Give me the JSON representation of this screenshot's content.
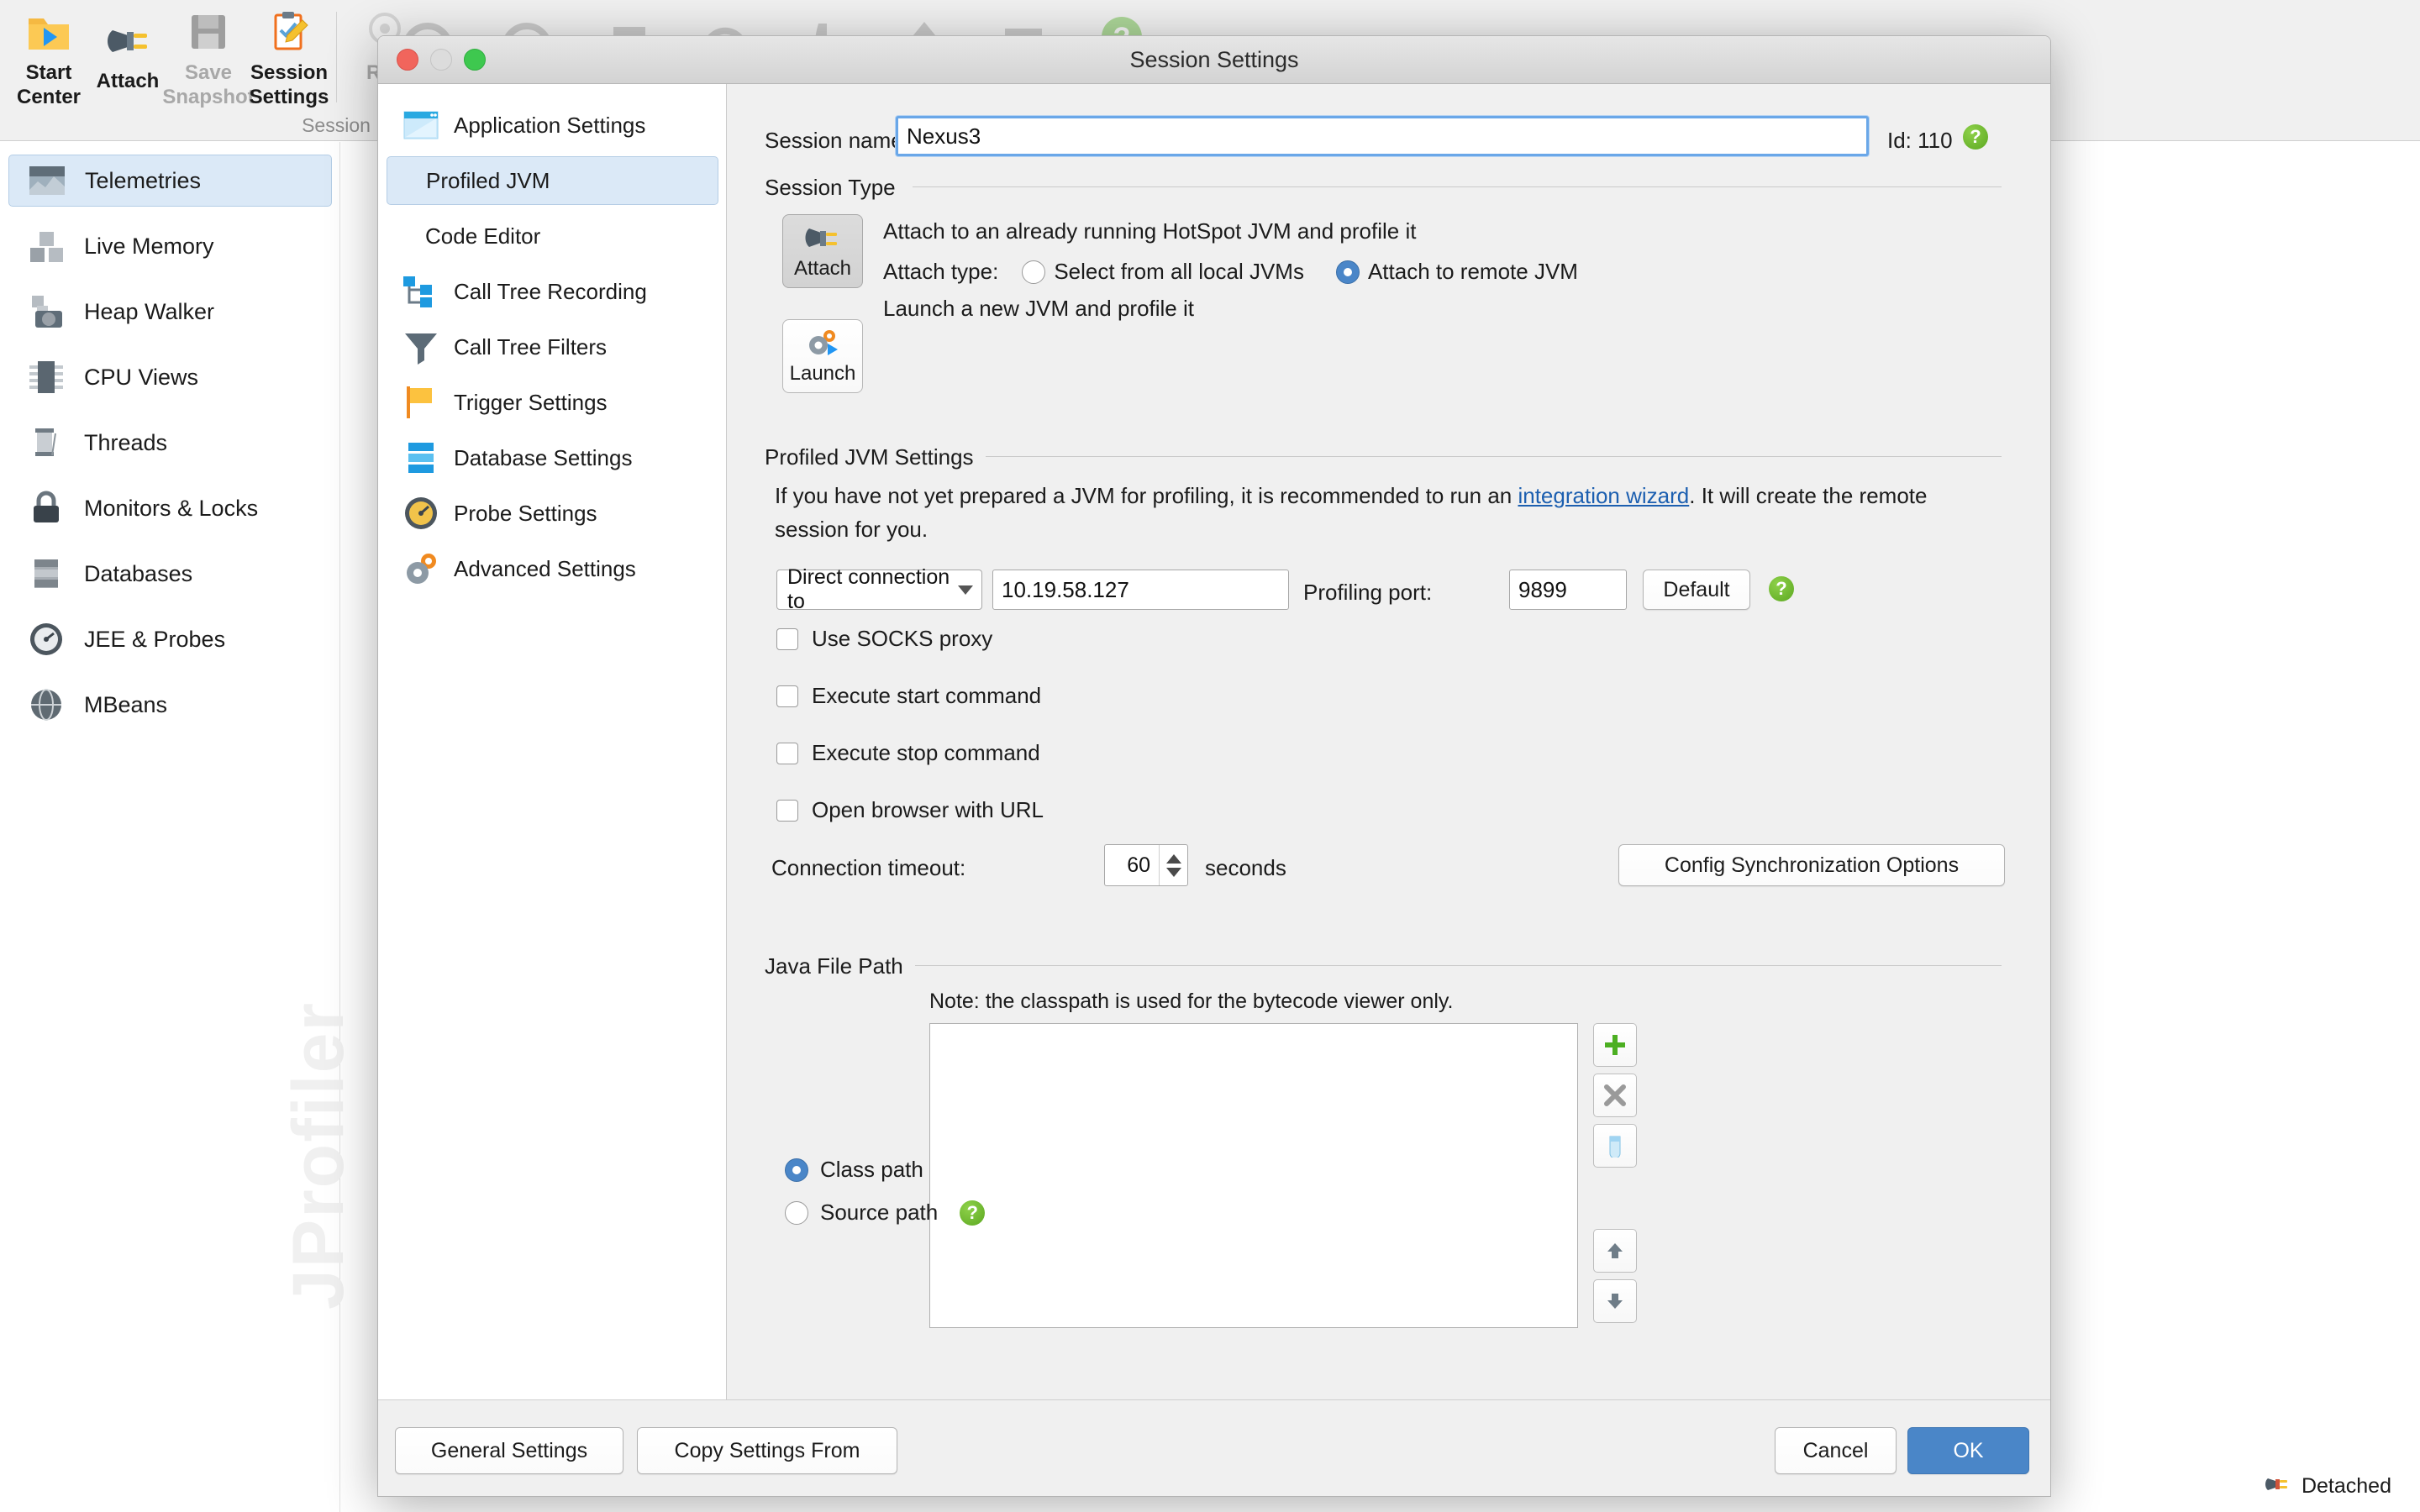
{
  "toolbar": {
    "group_label": "Session",
    "items": [
      {
        "label": "Start\nCenter",
        "icon": "folder-play-icon",
        "enabled": true
      },
      {
        "label": "Attach",
        "icon": "plug-icon",
        "enabled": true
      },
      {
        "label": "Save\nSnapshot",
        "icon": "floppy-icon",
        "enabled": false
      },
      {
        "label": "Session\nSettings",
        "icon": "clipboard-pencil-icon",
        "enabled": true
      },
      {
        "label": "Rec",
        "icon": "record-icon",
        "enabled": false
      }
    ]
  },
  "sidebar": {
    "items": [
      {
        "label": "Telemetries",
        "icon": "telemetries-icon",
        "selected": true
      },
      {
        "label": "Live Memory",
        "icon": "live-memory-icon",
        "selected": false
      },
      {
        "label": "Heap Walker",
        "icon": "heap-walker-icon",
        "selected": false
      },
      {
        "label": "CPU Views",
        "icon": "cpu-icon",
        "selected": false
      },
      {
        "label": "Threads",
        "icon": "threads-icon",
        "selected": false
      },
      {
        "label": "Monitors & Locks",
        "icon": "lock-icon",
        "selected": false
      },
      {
        "label": "Databases",
        "icon": "database-icon",
        "selected": false
      },
      {
        "label": "JEE & Probes",
        "icon": "probes-icon",
        "selected": false
      },
      {
        "label": "MBeans",
        "icon": "mbeans-icon",
        "selected": false
      }
    ],
    "watermark": "JProfiler"
  },
  "statusbar": {
    "text": "Detached",
    "icon": "detached-plug-icon"
  },
  "dialog": {
    "title": "Session Settings",
    "categories": [
      {
        "label": "Application Settings",
        "icon": "application-settings-icon",
        "selected": false,
        "indent": false
      },
      {
        "label": "Profiled JVM",
        "icon": "",
        "selected": true,
        "indent": true
      },
      {
        "label": "Code Editor",
        "icon": "",
        "selected": false,
        "indent": true
      },
      {
        "label": "Call Tree Recording",
        "icon": "call-tree-recording-icon",
        "selected": false,
        "indent": false
      },
      {
        "label": "Call Tree Filters",
        "icon": "funnel-icon",
        "selected": false,
        "indent": false
      },
      {
        "label": "Trigger Settings",
        "icon": "flag-icon",
        "selected": false,
        "indent": false
      },
      {
        "label": "Database Settings",
        "icon": "database-icon",
        "selected": false,
        "indent": false
      },
      {
        "label": "Probe Settings",
        "icon": "gauge-icon",
        "selected": false,
        "indent": false
      },
      {
        "label": "Advanced Settings",
        "icon": "gears-icon",
        "selected": false,
        "indent": false
      }
    ],
    "session_name": {
      "label": "Session name:",
      "value": "Nexus3",
      "id_label": "Id: 110",
      "help": "?"
    },
    "session_type": {
      "group_label": "Session Type",
      "attach_button": "Attach",
      "attach_description": "Attach to an already running HotSpot JVM and profile it",
      "attach_type_label": "Attach type:",
      "attach_type_options": [
        {
          "label": "Select from all local JVMs",
          "selected": false
        },
        {
          "label": "Attach to remote JVM",
          "selected": true
        }
      ],
      "launch_button": "Launch",
      "launch_description": "Launch a new JVM and profile it"
    },
    "profiled_jvm": {
      "group_label": "Profiled JVM Settings",
      "note_part1": "If you have not yet prepared a JVM for profiling, it is recommended to run an ",
      "note_link": "integration wizard",
      "note_part2": ". It will create the remote session for you.",
      "connection_type": "Direct connection to",
      "host": "10.19.58.127",
      "port_label": "Profiling port:",
      "port": "9899",
      "default_button": "Default",
      "help": "?",
      "checkboxes": [
        {
          "label": "Use SOCKS proxy",
          "checked": false
        },
        {
          "label": "Execute start command",
          "checked": false
        },
        {
          "label": "Execute stop command",
          "checked": false
        },
        {
          "label": "Open browser with URL",
          "checked": false
        }
      ],
      "timeout_label": "Connection timeout:",
      "timeout_value": "60",
      "timeout_unit": "seconds",
      "config_sync_button": "Config Synchronization Options"
    },
    "java_file_path": {
      "group_label": "Java File Path",
      "note": "Note: the classpath is used for the bytecode viewer only.",
      "path_entries": [],
      "path_type_options": [
        {
          "label": "Class path",
          "selected": true
        },
        {
          "label": "Source path",
          "selected": false
        }
      ],
      "help": "?",
      "side_buttons": [
        {
          "icon": "plus-icon",
          "name": "add-path-button"
        },
        {
          "icon": "remove-x-icon",
          "name": "remove-path-button"
        },
        {
          "icon": "jar-icon",
          "name": "add-jar-button"
        },
        {
          "icon": "arrow-up-icon",
          "name": "move-up-button"
        },
        {
          "icon": "arrow-down-icon",
          "name": "move-down-button"
        }
      ]
    },
    "footer": {
      "general_settings": "General Settings",
      "copy_settings_from": "Copy Settings From",
      "cancel": "Cancel",
      "ok": "OK"
    }
  },
  "colors": {
    "accent": "#4a86c8",
    "selection_bg": "#dbe9f7",
    "help_green": "#6cb82e",
    "window_bg": "#f0f0f0"
  }
}
